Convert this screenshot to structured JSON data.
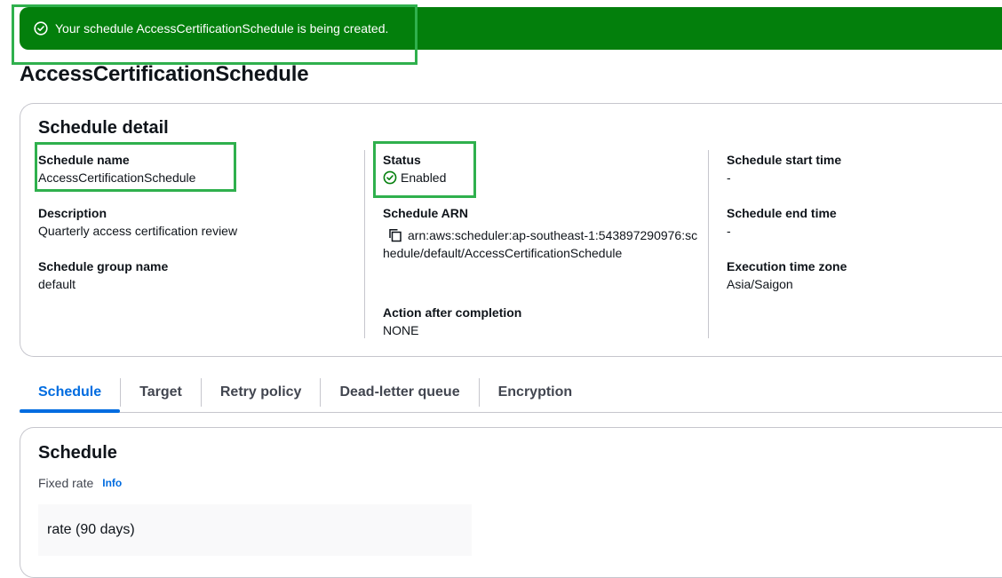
{
  "flash": {
    "message": "Your schedule AccessCertificationSchedule is being created.",
    "icon": "check-circle-icon",
    "color": "#037f0c"
  },
  "page_title": "AccessCertificationSchedule",
  "detail": {
    "heading": "Schedule detail",
    "schedule_name": {
      "label": "Schedule name",
      "value": "AccessCertificationSchedule"
    },
    "description": {
      "label": "Description",
      "value": "Quarterly access certification review"
    },
    "group_name": {
      "label": "Schedule group name",
      "value": "default"
    },
    "status": {
      "label": "Status",
      "value": "Enabled",
      "color": "#037f0c"
    },
    "arn": {
      "label": "Schedule ARN",
      "value": "arn:aws:scheduler:ap-southeast-1:543897290976:schedule/default/AccessCertificationSchedule",
      "copy_icon": "copy-icon"
    },
    "action_after": {
      "label": "Action after completion",
      "value": "NONE"
    },
    "start_time": {
      "label": "Schedule start time",
      "value": "-"
    },
    "end_time": {
      "label": "Schedule end time",
      "value": "-"
    },
    "time_zone": {
      "label": "Execution time zone",
      "value": "Asia/Saigon"
    }
  },
  "tabs": [
    {
      "label": "Schedule",
      "active": true
    },
    {
      "label": "Target",
      "active": false
    },
    {
      "label": "Retry policy",
      "active": false
    },
    {
      "label": "Dead-letter queue",
      "active": false
    },
    {
      "label": "Encryption",
      "active": false
    }
  ],
  "schedule_section": {
    "heading": "Schedule",
    "fixed_rate_label": "Fixed rate",
    "info_link": "Info",
    "rate_value": "rate (90 days)"
  },
  "colors": {
    "accent": "#006ce0",
    "success": "#037f0c",
    "highlight": "#2fb04d"
  }
}
